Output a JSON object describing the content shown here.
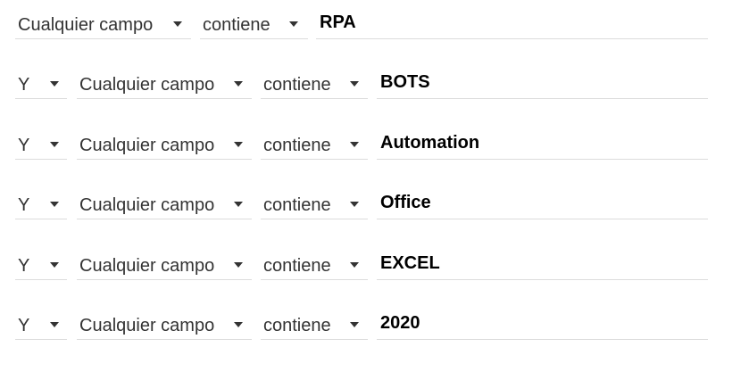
{
  "search_rows": [
    {
      "field": "Cualquier campo",
      "operator": "contiene",
      "term": "RPA"
    },
    {
      "boolean": "Y",
      "field": "Cualquier campo",
      "operator": "contiene",
      "term": "BOTS"
    },
    {
      "boolean": "Y",
      "field": "Cualquier campo",
      "operator": "contiene",
      "term": "Automation"
    },
    {
      "boolean": "Y",
      "field": "Cualquier campo",
      "operator": "contiene",
      "term": "Office"
    },
    {
      "boolean": "Y",
      "field": "Cualquier campo",
      "operator": "contiene",
      "term": "EXCEL"
    },
    {
      "boolean": "Y",
      "field": "Cualquier campo",
      "operator": "contiene",
      "term": "2020"
    }
  ],
  "icons": {
    "dropdown": "caret-down-icon"
  },
  "colors": {
    "divider": "#dcdcdc",
    "label": "#333333",
    "term": "#000000"
  }
}
